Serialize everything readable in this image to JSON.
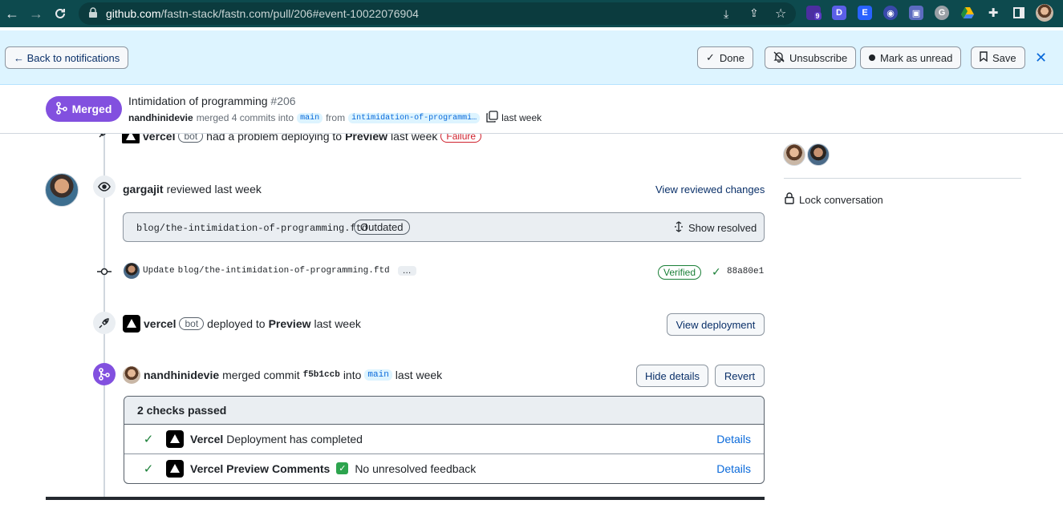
{
  "browser": {
    "url_host": "github.com",
    "url_path": "/fastn-stack/fastn.com/pull/206#event-10022076904",
    "extension_badge_count": "9"
  },
  "notification_bar": {
    "back_label": "← Back to notifications",
    "done_label": "Done",
    "unsubscribe_label": "Unsubscribe",
    "mark_unread_label": "Mark as unread",
    "save_label": "Save"
  },
  "pr": {
    "status": "Merged",
    "title": "Intimidation of programming",
    "number": "#206",
    "author": "nandhinidevie",
    "merged_text": "merged 4 commits into",
    "base_branch": "main",
    "from_text": "from",
    "head_branch": "intimidation-of-programmi…",
    "time": "last week"
  },
  "timeline": {
    "failure_event": {
      "actor": "vercel",
      "bot_label": "bot",
      "text_a": "had a problem deploying to",
      "env": "Preview",
      "time": "last week",
      "status": "Failure"
    },
    "review": {
      "actor": "gargajit",
      "text": "reviewed last week",
      "link": "View reviewed changes",
      "file": "blog/the-intimidation-of-programming.ftd",
      "outdated": "Outdated",
      "show_resolved": "Show resolved"
    },
    "commit": {
      "message_prefix": "Update",
      "message_file": "blog/the-intimidation-of-programming.ftd",
      "ellipsis": "…",
      "verified": "Verified",
      "sha": "88a80e1"
    },
    "deploy": {
      "actor": "vercel",
      "bot_label": "bot",
      "text_a": "deployed to",
      "env": "Preview",
      "time": "last week",
      "button": "View deployment"
    },
    "merge": {
      "actor": "nandhinidevie",
      "text_a": "merged commit",
      "sha": "f5b1ccb",
      "text_b": "into",
      "branch": "main",
      "time": "last week",
      "hide_button": "Hide details",
      "revert_button": "Revert"
    },
    "checks": {
      "header": "2 checks passed",
      "rows": [
        {
          "name": "Vercel",
          "desc": "Deployment has completed",
          "details": "Details"
        },
        {
          "name": "Vercel Preview Comments",
          "desc": "No unresolved feedback",
          "details": "Details"
        }
      ]
    }
  },
  "sidebar": {
    "lock_label": "Lock conversation"
  },
  "colors": {
    "merged_purple": "#8250df",
    "link_blue": "#0969da",
    "success_green": "#1a7f37",
    "failure_red": "#cf222e",
    "notif_bg": "#ddf4ff"
  }
}
